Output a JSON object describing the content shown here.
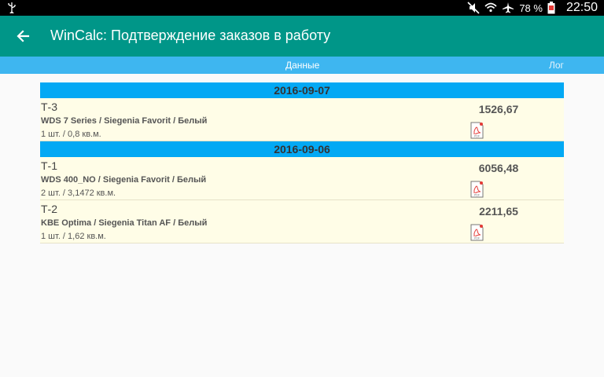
{
  "status_bar": {
    "battery_percent": "78 %",
    "time": "22:50",
    "icons": [
      "usb-icon",
      "mute-icon",
      "wifi-icon",
      "airplane-icon",
      "battery-icon"
    ]
  },
  "app_bar": {
    "title": "WinCalc: Подтверждение заказов в работу",
    "back_icon": "arrow-left-icon"
  },
  "tabs": [
    {
      "label": "Данные",
      "selected": true
    },
    {
      "label": "Лог",
      "selected": false
    }
  ],
  "groups": [
    {
      "date": "2016-09-07",
      "orders": [
        {
          "number": "Т-3",
          "product": "WDS 7 Series / Siegenia Favorit / Белый",
          "quantity": "1 шт. / 0,8 кв.м.",
          "price": "1526,67",
          "icon": "pdf-icon"
        }
      ]
    },
    {
      "date": "2016-09-06",
      "orders": [
        {
          "number": "Т-1",
          "product": "WDS 400_NO / Siegenia Favorit / Белый",
          "quantity": "2 шт. / 3,1472 кв.м.",
          "price": "6056,48",
          "icon": "pdf-icon"
        },
        {
          "number": "Т-2",
          "product": "KBE Optima / Siegenia Titan AF / Белый",
          "quantity": "1 шт. / 1,62 кв.м.",
          "price": "2211,65",
          "icon": "pdf-icon"
        }
      ]
    }
  ],
  "colors": {
    "app_bar": "#009688",
    "tab_bar": "#3eb6f0",
    "date_header": "#03a9f4",
    "order_background": "#fffde7"
  }
}
